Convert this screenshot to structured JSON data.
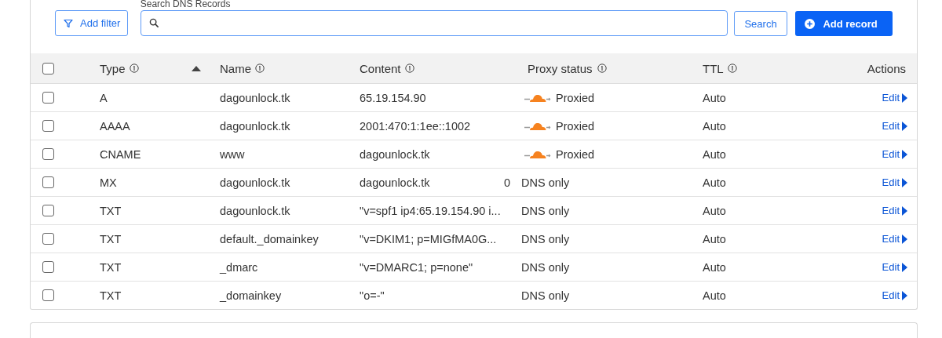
{
  "toolbar": {
    "filter_button": "Add filter",
    "search_label": "Search DNS Records",
    "search_button": "Search",
    "add_button": "Add record"
  },
  "table": {
    "select_all_checked": false,
    "columns": [
      {
        "label": "Type",
        "info": true,
        "sorted": true
      },
      {
        "label": "Name",
        "info": true,
        "sorted": false
      },
      {
        "label": "Content",
        "info": true,
        "sorted": false
      },
      {
        "label": "Proxy status",
        "info": true,
        "sorted": false
      },
      {
        "label": "TTL",
        "info": true,
        "sorted": false
      },
      {
        "label": "Actions",
        "info": false,
        "sorted": false
      }
    ],
    "rows": [
      {
        "checked": false,
        "type": "A",
        "name": "dagounlock.tk",
        "content": "65.19.154.90",
        "proxy": {
          "kind": "proxied",
          "label": "Proxied"
        },
        "ttl": "Auto",
        "action": "Edit"
      },
      {
        "checked": false,
        "type": "AAAA",
        "name": "dagounlock.tk",
        "content": "2001:470:1:1ee::1002",
        "proxy": {
          "kind": "proxied",
          "label": "Proxied"
        },
        "ttl": "Auto",
        "action": "Edit"
      },
      {
        "checked": false,
        "type": "CNAME",
        "name": "www",
        "content": "dagounlock.tk",
        "proxy": {
          "kind": "proxied",
          "label": "Proxied"
        },
        "ttl": "Auto",
        "action": "Edit"
      },
      {
        "checked": false,
        "type": "MX",
        "name": "dagounlock.tk",
        "content": "dagounlock.tk",
        "priority": "0",
        "proxy": {
          "kind": "dns_only",
          "label": "DNS only"
        },
        "ttl": "Auto",
        "action": "Edit"
      },
      {
        "checked": false,
        "type": "TXT",
        "name": "dagounlock.tk",
        "content": "\"v=spf1 ip4:65.19.154.90 i...",
        "proxy": {
          "kind": "dns_only",
          "label": "DNS only"
        },
        "ttl": "Auto",
        "action": "Edit"
      },
      {
        "checked": false,
        "type": "TXT",
        "name": "default._domainkey",
        "content": "\"v=DKIM1; p=MIGfMA0G...",
        "proxy": {
          "kind": "dns_only",
          "label": "DNS only"
        },
        "ttl": "Auto",
        "action": "Edit"
      },
      {
        "checked": false,
        "type": "TXT",
        "name": "_dmarc",
        "content": "\"v=DMARC1; p=none\"",
        "proxy": {
          "kind": "dns_only",
          "label": "DNS only"
        },
        "ttl": "Auto",
        "action": "Edit"
      },
      {
        "checked": false,
        "type": "TXT",
        "name": "_domainkey",
        "content": "\"o=-\"",
        "proxy": {
          "kind": "dns_only",
          "label": "DNS only"
        },
        "ttl": "Auto",
        "action": "Edit"
      }
    ]
  }
}
